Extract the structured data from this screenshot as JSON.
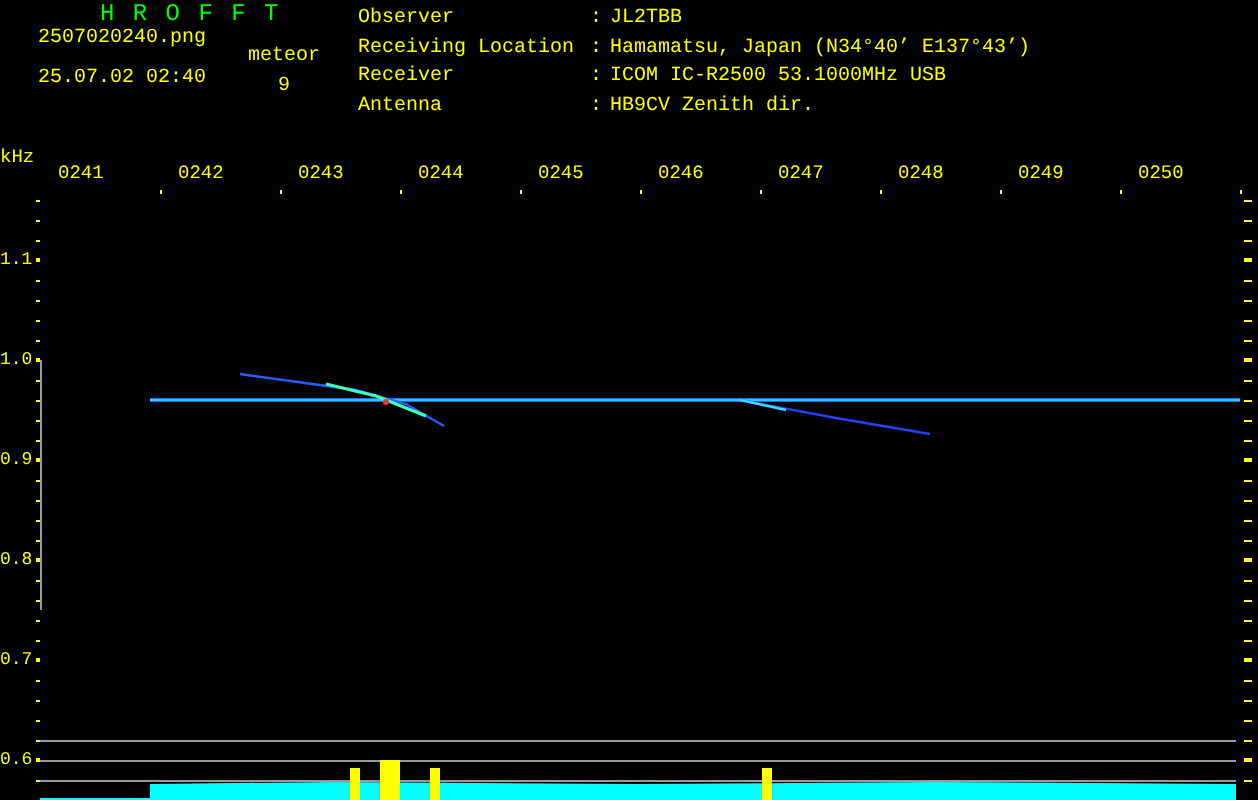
{
  "app_title": "H R O F F T",
  "file": {
    "name": "2507020240.png",
    "datetime": "25.07.02 02:40"
  },
  "count": {
    "label": "meteor",
    "value": "9"
  },
  "info": [
    {
      "label": "Observer",
      "separator": ":",
      "value": "JL2TBB"
    },
    {
      "label": "Receiving Location",
      "separator": ":",
      "value": "Hamamatsu, Japan (N34°40’ E137°43’)"
    },
    {
      "label": "Receiver",
      "separator": ":",
      "value": "ICOM IC-R2500 53.1000MHz USB"
    },
    {
      "label": "Antenna",
      "separator": ":",
      "value": "HB9CV Zenith dir."
    }
  ],
  "y_unit": "kHz",
  "x_labels": [
    "0241",
    "0242",
    "0243",
    "0244",
    "0245",
    "0246",
    "0247",
    "0248",
    "0249",
    "0250"
  ],
  "y_labels": [
    "1.1",
    "1.0",
    "0.9",
    "0.8",
    "0.7",
    "0.6"
  ]
}
